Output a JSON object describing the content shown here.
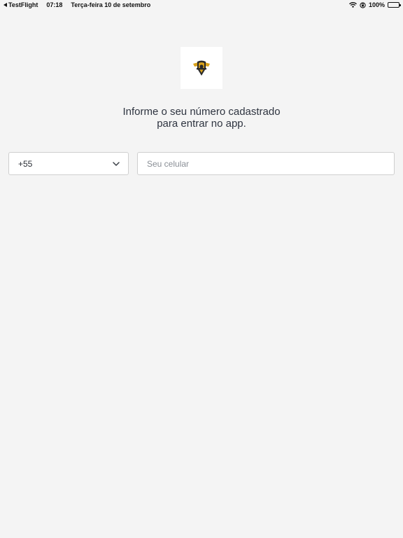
{
  "status_bar": {
    "back_app": "TestFlight",
    "time": "07:18",
    "date": "Terça-feira 10 de setembro",
    "battery": "100%"
  },
  "login": {
    "headline_line1": "Informe o seu número cadastrado",
    "headline_line2": "para entrar no app.",
    "country_code": "+55",
    "phone_placeholder": "Seu celular",
    "phone_value": ""
  },
  "colors": {
    "background": "#f4f4f4",
    "field_border": "#cfcfcf",
    "logo_gold": "#d9a21b"
  },
  "icons": {
    "back": "chevron-left-icon",
    "wifi": "wifi-icon",
    "rotation_lock": "rotation-lock-icon",
    "battery": "battery-icon",
    "dropdown": "chevron-down-icon",
    "logo": "app-logo-icon"
  }
}
